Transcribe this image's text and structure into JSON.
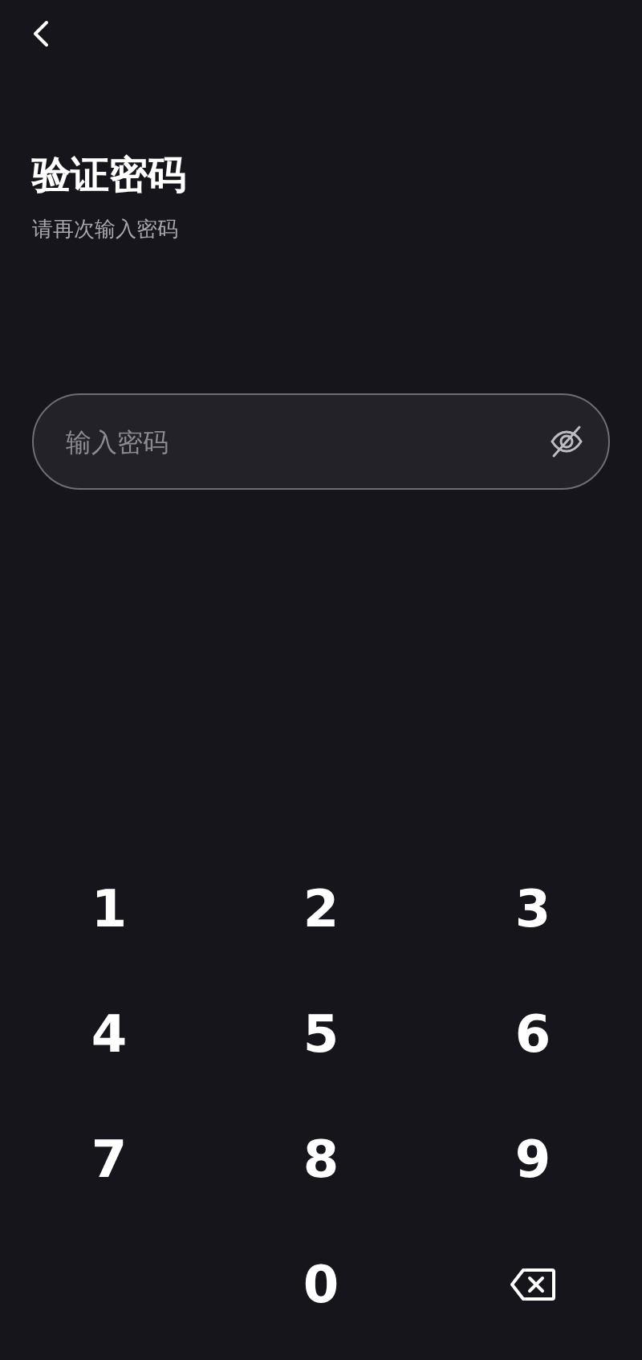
{
  "title": "验证密码",
  "subtitle": "请再次输入密码",
  "password_field": {
    "placeholder": "输入密码"
  },
  "keypad": [
    {
      "kind": "digit",
      "label": "1"
    },
    {
      "kind": "digit",
      "label": "2"
    },
    {
      "kind": "digit",
      "label": "3"
    },
    {
      "kind": "digit",
      "label": "4"
    },
    {
      "kind": "digit",
      "label": "5"
    },
    {
      "kind": "digit",
      "label": "6"
    },
    {
      "kind": "digit",
      "label": "7"
    },
    {
      "kind": "digit",
      "label": "8"
    },
    {
      "kind": "digit",
      "label": "9"
    },
    {
      "kind": "blank"
    },
    {
      "kind": "digit",
      "label": "0"
    },
    {
      "kind": "backspace"
    }
  ]
}
